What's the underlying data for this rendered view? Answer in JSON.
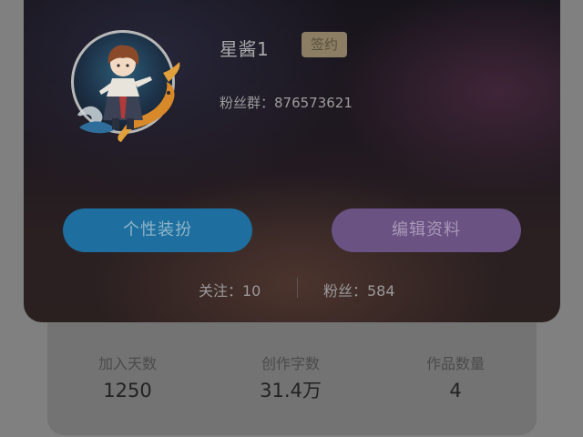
{
  "profile": {
    "username": "星酱1",
    "badge": "签约",
    "fan_group": "粉丝群：876573621",
    "avatar_icon": "anime-character-koi-avatar",
    "buttons": {
      "dress_up": "个性装扮",
      "edit_profile": "编辑资料"
    },
    "following": "关注：10",
    "followers": "粉丝：584"
  },
  "stats": [
    {
      "label": "加入天数",
      "value": "1250"
    },
    {
      "label": "创作字数",
      "value": "31.4万"
    },
    {
      "label": "作品数量",
      "value": "4"
    }
  ],
  "colors": {
    "dress_button": "#1e6f9f",
    "edit_button": "#6a5283",
    "badge": "#8b7e65"
  }
}
